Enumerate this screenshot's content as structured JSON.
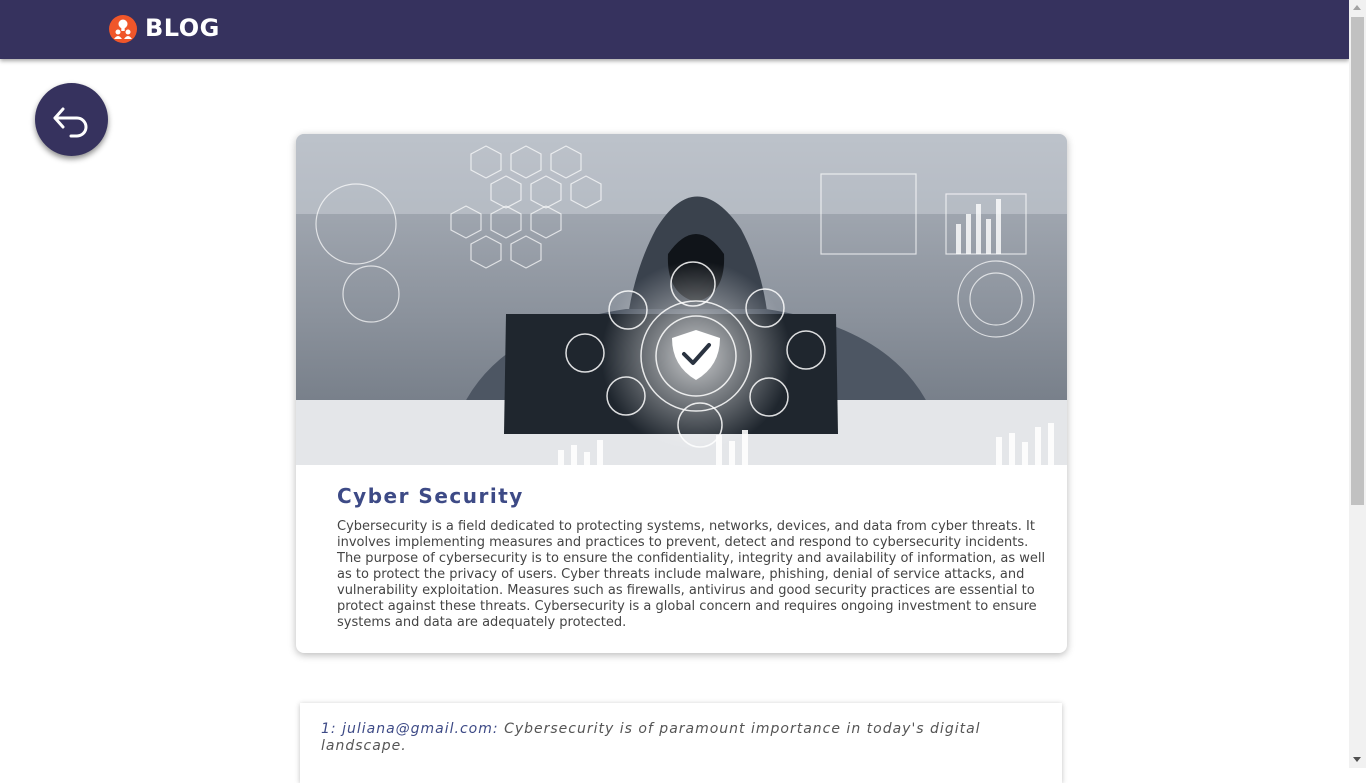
{
  "header": {
    "brand": "BLOG",
    "logo_icon": "people-lightbulb-icon",
    "background_color": "#36325e",
    "logo_color": "#f0562a"
  },
  "back_button": {
    "icon": "undo-arrow-icon"
  },
  "post": {
    "image_alt": "hooded hacker at laptop with cybersecurity shield icons",
    "title": "Cyber Security",
    "body": "Cybersecurity is a field dedicated to protecting systems, networks, devices, and data from cyber threats. It involves implementing measures and practices to prevent, detect and respond to cybersecurity incidents. The purpose of cybersecurity is to ensure the confidentiality, integrity and availability of information, as well as to protect the privacy of users. Cyber threats include malware, phishing, denial of service attacks, and vulnerability exploitation. Measures such as firewalls, antivirus and good security practices are essential to protect against these threats. Cybersecurity is a global concern and requires ongoing investment to ensure systems and data are adequately protected."
  },
  "comments": [
    {
      "author": "1: juliana@gmail.com:",
      "text": "Cybersecurity is of paramount importance in today's digital landscape."
    }
  ]
}
